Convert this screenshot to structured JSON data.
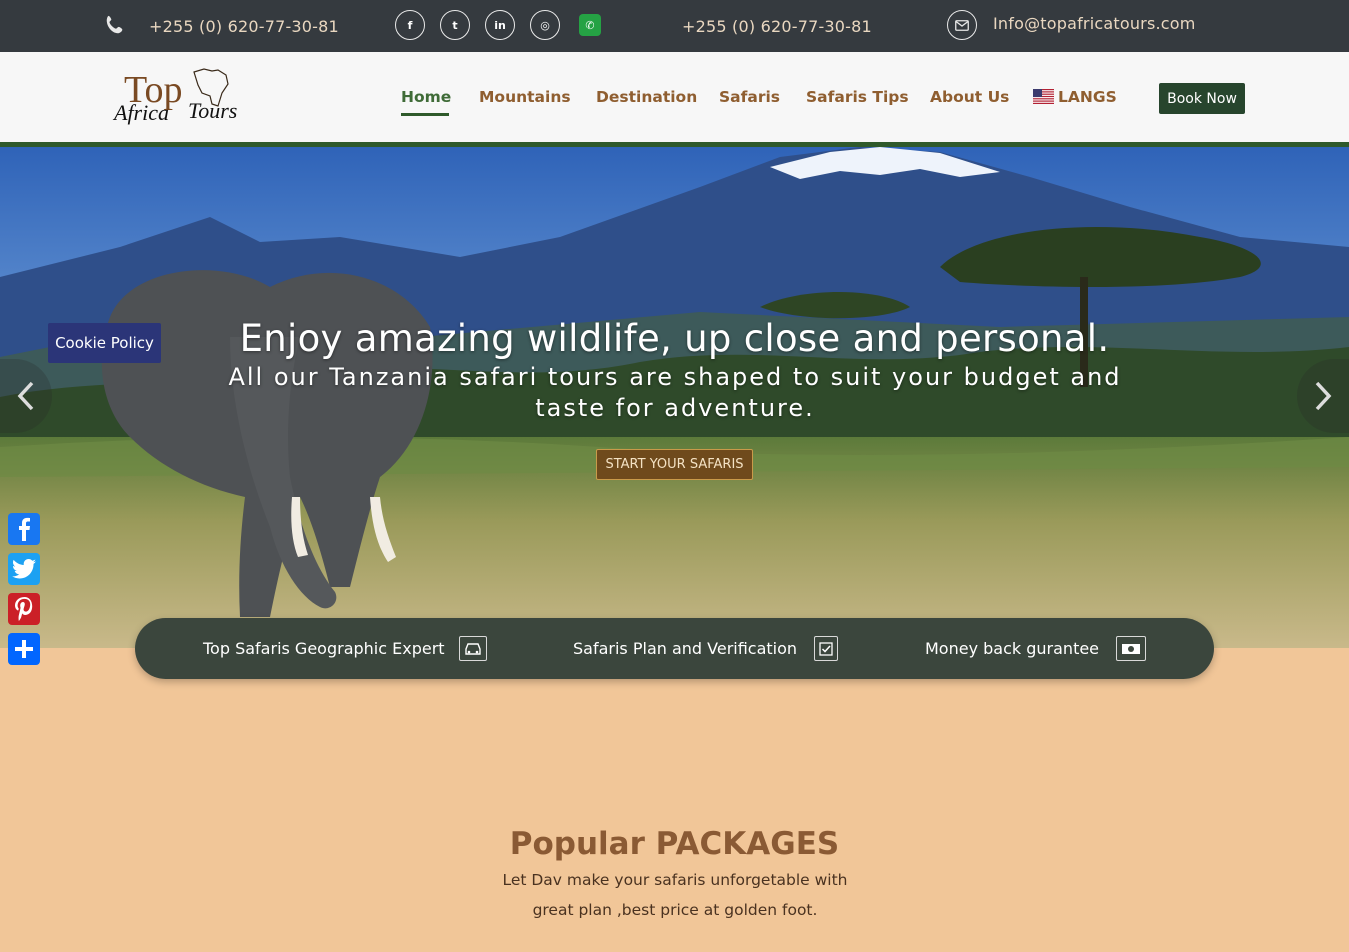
{
  "topbar": {
    "phone_1": "+255 (0) 620-77-30-81",
    "phone_2": "+255 (0) 620-77-30-81",
    "email": "Info@topafricatours.com",
    "social_icons": [
      "facebook-icon",
      "twitter-icon",
      "linkedin-icon",
      "instagram-icon",
      "whatsapp-icon"
    ],
    "social_glyphs": [
      "f",
      "t",
      "in",
      "◎",
      "✆"
    ]
  },
  "logo": {
    "line1": "Top",
    "line2": "Africa Tours"
  },
  "nav": {
    "items": [
      {
        "label": "Home"
      },
      {
        "label": "Mountains"
      },
      {
        "label": "Destination"
      },
      {
        "label": "Safaris"
      },
      {
        "label": "Safaris Tips"
      },
      {
        "label": "About Us"
      },
      {
        "label": "LANGS"
      }
    ],
    "book_label": "Book Now",
    "active_color": "#3f6b37",
    "link_color": "#8f5e30"
  },
  "hero": {
    "title": "Enjoy amazing wildlife, up close and personal.",
    "subtitle": "All our Tanzania safari tours are shaped to suit your budget and taste for adventure.",
    "cta": "START YOUR SAFARIS"
  },
  "cookie": {
    "label": "Cookie Policy"
  },
  "features": [
    {
      "label": "Top Safaris Geographic Expert",
      "icon": "car-icon"
    },
    {
      "label": "Safaris Plan and Verification",
      "icon": "checkbox-icon"
    },
    {
      "label": "Money back gurantee",
      "icon": "money-icon"
    }
  ],
  "share": [
    "facebook-share-icon",
    "twitter-share-icon",
    "pinterest-share-icon",
    "add-share-icon"
  ],
  "packages": {
    "title": "Popular PACKAGES",
    "subtitle_line1": "Let Dav make your safaris unforgetable with",
    "subtitle_line2": "great plan ,best price at golden foot."
  }
}
